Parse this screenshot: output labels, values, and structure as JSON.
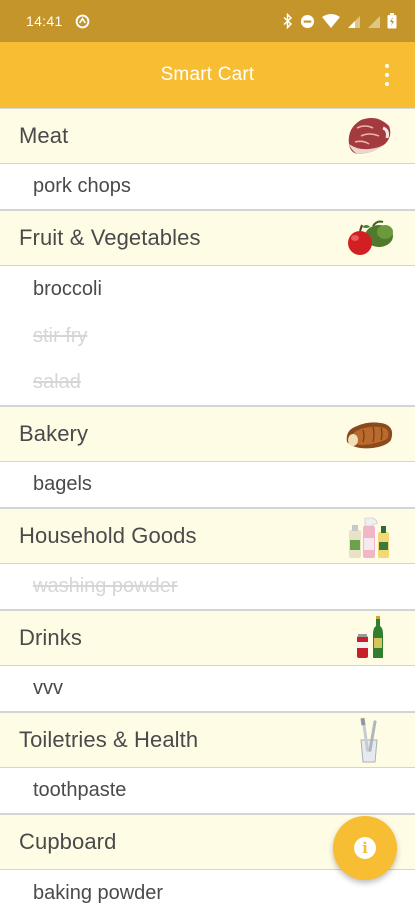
{
  "status_bar": {
    "time": "14:41",
    "left_icon": "sync-circle-icon",
    "right_icons": [
      "bluetooth-icon",
      "do-not-disturb-icon",
      "wifi-icon",
      "signal-icon",
      "signal-icon",
      "battery-charging-icon"
    ]
  },
  "app_bar": {
    "title": "Smart Cart",
    "menu_icon": "overflow-menu-icon"
  },
  "list": {
    "categories": [
      {
        "name": "Meat",
        "icon": "meat-steak-icon",
        "items": [
          {
            "label": "pork chops",
            "done": false
          }
        ]
      },
      {
        "name": "Fruit & Vegetables",
        "icon": "apple-vegetables-icon",
        "items": [
          {
            "label": "broccoli",
            "done": false
          },
          {
            "label": "stir fry",
            "done": true
          },
          {
            "label": "salad",
            "done": true
          }
        ]
      },
      {
        "name": "Bakery",
        "icon": "bread-loaf-icon",
        "items": [
          {
            "label": "bagels",
            "done": false
          }
        ]
      },
      {
        "name": "Household Goods",
        "icon": "cleaning-bottles-icon",
        "items": [
          {
            "label": "washing powder",
            "done": true
          }
        ]
      },
      {
        "name": "Drinks",
        "icon": "drink-bottles-icon",
        "items": [
          {
            "label": "vvv",
            "done": false
          }
        ]
      },
      {
        "name": "Toiletries & Health",
        "icon": "toothbrush-cup-icon",
        "items": [
          {
            "label": "toothpaste",
            "done": false
          }
        ]
      },
      {
        "name": "Cupboard",
        "icon": "",
        "items": [
          {
            "label": "baking powder",
            "done": false
          }
        ]
      }
    ]
  },
  "fab": {
    "icon": "info-icon",
    "symbol": "i"
  },
  "colors": {
    "status_bar": "#c4952a",
    "app_bar": "#f7bd33",
    "category_background": "#fffce6",
    "text": "#4a4a4a",
    "done_text": "#d6d6d6"
  }
}
